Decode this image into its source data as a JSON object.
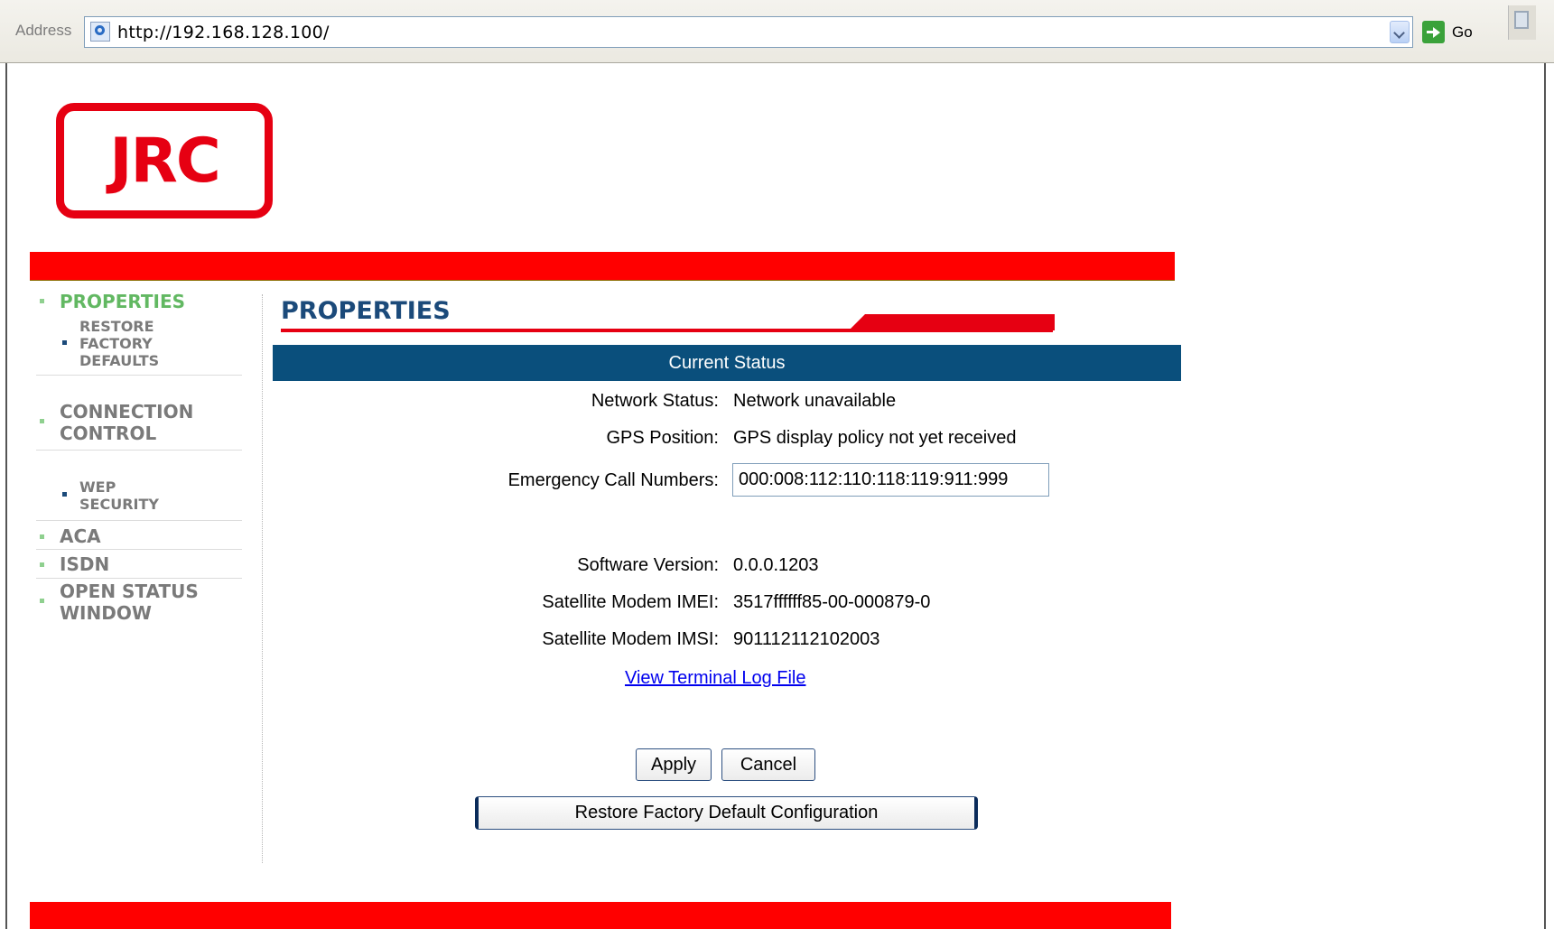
{
  "browser": {
    "address_label": "Address",
    "url": "http://192.168.128.100/",
    "go_label": "Go"
  },
  "logo": {
    "text": "JRC"
  },
  "sidebar": {
    "items": [
      {
        "label": "PROPERTIES",
        "active": true
      },
      {
        "label": "RESTORE FACTORY DEFAULTS",
        "sub": true
      },
      {
        "label": "CONNECTION CONTROL"
      },
      {
        "label": "WEP SECURITY",
        "sub": true
      },
      {
        "label": "ACA"
      },
      {
        "label": "ISDN"
      },
      {
        "label": "OPEN STATUS WINDOW"
      }
    ]
  },
  "main": {
    "heading": "PROPERTIES",
    "status_bar": "Current Status",
    "fields": {
      "network_status_label": "Network Status:",
      "network_status_value": "Network unavailable",
      "gps_label": "GPS Position:",
      "gps_value": "GPS display policy not yet received",
      "ecn_label": "Emergency Call Numbers:",
      "ecn_value": "000:008:112:110:118:119:911:999",
      "sw_label": "Software Version:",
      "sw_value": "0.0.0.1203",
      "imei_label": "Satellite Modem IMEI:",
      "imei_value": "3517ffffff85-00-000879-0",
      "imsi_label": "Satellite Modem IMSI:",
      "imsi_value": "901112112102003"
    },
    "log_link": "View Terminal Log File",
    "apply_label": "Apply",
    "cancel_label": "Cancel",
    "restore_label": "Restore Factory Default Configuration"
  },
  "colors": {
    "brand_red": "#e60012",
    "bar_red": "#ff0000",
    "header_blue": "#0a4f7c",
    "heading_navy": "#1b4a7a",
    "active_nav_green": "#62b862",
    "nav_gray": "#7a7a7a"
  }
}
